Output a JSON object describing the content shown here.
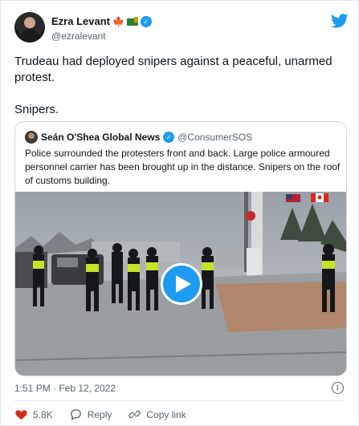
{
  "author": {
    "display_name": "Ezra Levant",
    "handle": "@ezralevant",
    "emoji_1": "maple-leaf",
    "emoji_2": "truck",
    "verified": true
  },
  "tweet": {
    "paragraphs": [
      "Trudeau had deployed snipers against a peaceful, unarmed protest.",
      "Snipers."
    ],
    "timestamp": "1:51 PM · Feb 12, 2022"
  },
  "quoted_tweet": {
    "display_name": "Seán O'Shea Global News",
    "handle": "@ConsumerSOS",
    "verified": true,
    "text": "Police surrounded the protesters front and back. Large police armoured personnel carrier has been brought up in the distance. Snipers on the roof of customs building.",
    "media": "video"
  },
  "actions": {
    "like_count": "5.8K",
    "reply_label": "Reply",
    "copy_link_label": "Copy link"
  },
  "colors": {
    "accent": "#1d9bf0",
    "like_red": "#d52b1e",
    "secondary_text": "#536471"
  },
  "icons": [
    "twitter-bird-icon",
    "verified-badge-icon",
    "play-icon",
    "info-icon",
    "heart-icon",
    "reply-icon",
    "copy-link-icon"
  ]
}
